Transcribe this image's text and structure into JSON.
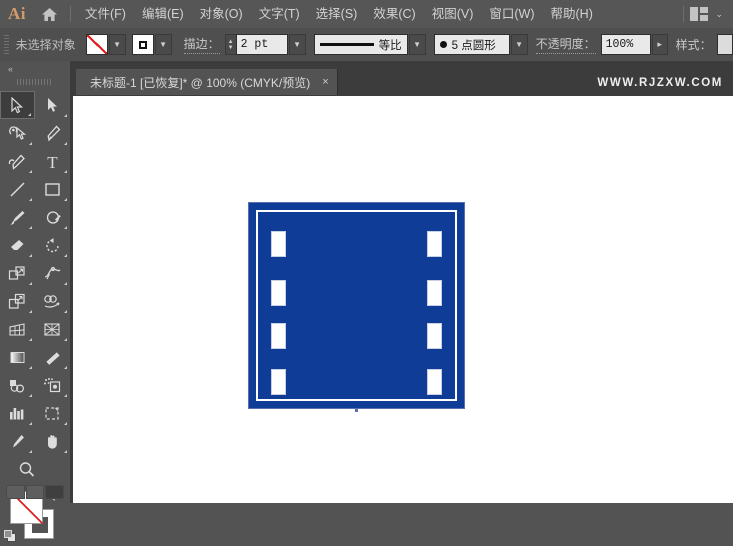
{
  "app": {
    "name": "Ai",
    "logo_icon": "illustrator-logo-icon",
    "home_icon": "home-icon"
  },
  "menubar": {
    "items": [
      {
        "label": "文件(F)",
        "name": "menu-file"
      },
      {
        "label": "编辑(E)",
        "name": "menu-edit"
      },
      {
        "label": "对象(O)",
        "name": "menu-object"
      },
      {
        "label": "文字(T)",
        "name": "menu-type"
      },
      {
        "label": "选择(S)",
        "name": "menu-select"
      },
      {
        "label": "效果(C)",
        "name": "menu-effect"
      },
      {
        "label": "视图(V)",
        "name": "menu-view"
      },
      {
        "label": "窗口(W)",
        "name": "menu-window"
      },
      {
        "label": "帮助(H)",
        "name": "menu-help"
      }
    ],
    "arrange_documents_icon": "arrange-documents-icon",
    "arrange_chevron": "⌄"
  },
  "controlbar": {
    "grip_icon": "panel-grip-icon",
    "selection_status": "未选择对象",
    "fill": {
      "label_icon": "fill-swatch-none-icon",
      "value": "无",
      "dropdown_icon": "chevron-down-icon"
    },
    "stroke_swatch": {
      "label_icon": "stroke-swatch-icon",
      "value": "黑色",
      "dropdown_icon": "chevron-down-icon"
    },
    "stroke": {
      "label": "描边：",
      "weight": "2 pt",
      "stepper_icon": "stepper-updown-icon",
      "dropdown_icon": "chevron-down-icon"
    },
    "profile": {
      "label": "等比",
      "preview_icon": "stroke-profile-uniform-icon",
      "dropdown_icon": "chevron-down-icon"
    },
    "brush": {
      "label": "5 点圆形",
      "preview_icon": "round-brush-dot-icon",
      "dropdown_icon": "chevron-down-icon"
    },
    "opacity": {
      "label": "不透明度：",
      "value": "100%",
      "flyout_icon": "chevron-right-icon"
    },
    "style": {
      "label": "样式：",
      "swatch_icon": "graphic-style-swatch-icon"
    }
  },
  "tabbar": {
    "document": {
      "title": "未标题-1 [已恢复]* @ 100% (CMYK/预览)",
      "close_icon": "×"
    },
    "watermark": "WWW.RJZXW.COM"
  },
  "toolbar": {
    "collapse_icon": "«",
    "grip_icon": "toolbar-grip-icon",
    "tools": [
      {
        "name": "selection-tool",
        "label": "选择工具",
        "active": true
      },
      {
        "name": "direct-selection-tool",
        "label": "直接选择工具",
        "active": false
      },
      {
        "name": "magic-wand-tool",
        "label": "魔棒工具",
        "active": false
      },
      {
        "name": "pen-tool",
        "label": "钢笔工具",
        "active": false
      },
      {
        "name": "curvature-tool",
        "label": "曲率工具",
        "active": false
      },
      {
        "name": "type-tool",
        "label": "文字工具",
        "active": false
      },
      {
        "name": "line-segment-tool",
        "label": "直线段工具",
        "active": false
      },
      {
        "name": "rectangle-tool",
        "label": "矩形工具",
        "active": false
      },
      {
        "name": "paintbrush-tool",
        "label": "画笔工具",
        "active": false
      },
      {
        "name": "shaper-tool",
        "label": "Shaper 工具",
        "active": false
      },
      {
        "name": "eraser-tool",
        "label": "橡皮擦工具",
        "active": false
      },
      {
        "name": "rotate-tool",
        "label": "旋转工具",
        "active": false
      },
      {
        "name": "scale-tool",
        "label": "比例缩放工具",
        "active": false
      },
      {
        "name": "width-tool",
        "label": "宽度工具",
        "active": false
      },
      {
        "name": "free-transform-tool",
        "label": "自由变换工具",
        "active": false
      },
      {
        "name": "shape-builder-tool",
        "label": "形状生成器工具",
        "active": false
      },
      {
        "name": "perspective-grid-tool",
        "label": "透视网格工具",
        "active": false
      },
      {
        "name": "mesh-tool",
        "label": "网格工具",
        "active": false
      },
      {
        "name": "gradient-tool",
        "label": "渐变工具",
        "active": false
      },
      {
        "name": "eyedropper-tool",
        "label": "吸管工具",
        "active": false
      },
      {
        "name": "blend-tool",
        "label": "混合工具",
        "active": false
      },
      {
        "name": "symbol-sprayer-tool",
        "label": "符号喷枪工具",
        "active": false
      },
      {
        "name": "column-graph-tool",
        "label": "柱形图工具",
        "active": false
      },
      {
        "name": "artboard-tool",
        "label": "画板工具",
        "active": false
      },
      {
        "name": "slice-tool",
        "label": "切片工具",
        "active": false
      },
      {
        "name": "hand-tool",
        "label": "抓手工具",
        "active": false
      },
      {
        "name": "zoom-tool",
        "label": "缩放工具",
        "active": false
      }
    ],
    "fill_stroke": {
      "fill_icon": "fill-none-swatch-icon",
      "stroke_icon": "stroke-swatch-icon",
      "swap_icon": "swap-fill-stroke-icon",
      "default_icon": "default-fill-stroke-icon"
    },
    "color_modes": [
      {
        "name": "color-mode-button",
        "label": "颜色"
      },
      {
        "name": "gradient-mode-button",
        "label": "渐变"
      },
      {
        "name": "none-mode-button",
        "label": "无"
      }
    ]
  },
  "canvas": {
    "background_color": "#ffffff",
    "artwork": {
      "name": "film-strip-shape",
      "fill_color": "#0f3c96",
      "inner_border_color": "#ffffff",
      "perforation_color": "#ffffff",
      "perforations_per_side": 4
    }
  },
  "colors": {
    "menubar_bg": "#565656",
    "controlbar_bg": "#4f4f4f",
    "panel_bg": "#535353",
    "canvas_frame": "#3c3c3c",
    "accent_brand": "#d49b6a",
    "artwork_blue": "#0f3c96",
    "none_red": "#e02020"
  }
}
